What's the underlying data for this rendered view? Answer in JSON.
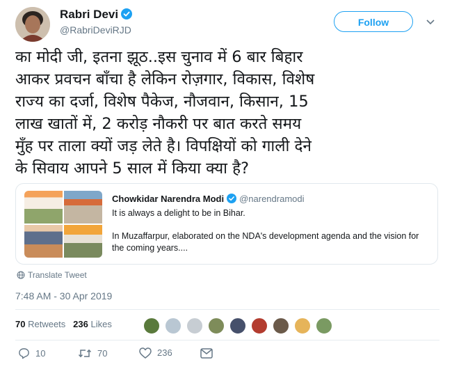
{
  "author": {
    "name": "Rabri Devi",
    "handle": "@RabriDeviRJD"
  },
  "follow_label": "Follow",
  "tweet_text": "का मोदी जी, इतना झूठ..इस चुनाव में 6 बार बिहार\nआकर प्रवचन बाँचा है लेकिन रोज़गार, विकास, विशेष\nराज्य का दर्जा, विशेष पैकेज, नौजवान, किसान, 15\nलाख खातों में, 2 करोड़ नौकरी पर बात करते समय\nमुँह पर ताला क्यों जड़ लेते है। विपक्षियों को गाली देने\nके सिवाय आपने 5 साल में किया क्या है?",
  "quoted": {
    "name": "Chowkidar Narendra Modi",
    "handle": "@narendramodi",
    "line1": "It is always a delight to be in Bihar.",
    "line2": "In Muzaffarpur, elaborated on the NDA's development agenda and the vision for the coming years...."
  },
  "translate_label": "Translate Tweet",
  "timestamp": "7:48 AM - 30 Apr 2019",
  "stats": {
    "retweets_count": "70",
    "retweets_label": "Retweets",
    "likes_count": "236",
    "likes_label": "Likes"
  },
  "actions": {
    "replies": "10",
    "retweets": "70",
    "likes": "236"
  },
  "colors": {
    "accent": "#1da1f2",
    "secondary_text": "#657786",
    "verified": "#1da1f2"
  },
  "icons": [
    "verified-icon",
    "chevron-down-icon",
    "globe-icon",
    "reply-icon",
    "retweet-icon",
    "like-icon",
    "message-icon"
  ]
}
